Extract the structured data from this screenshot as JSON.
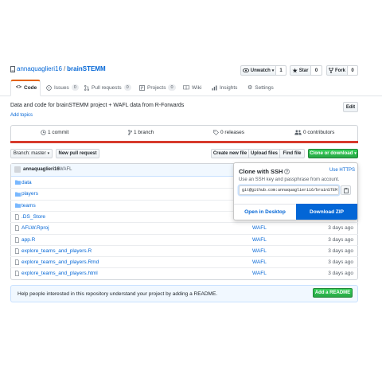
{
  "repo": {
    "owner": "annaquaglieri16",
    "separator": "/",
    "name": "brainSTEMM",
    "description": "Data and code for brainSTEMM project + WAFL data from R-Forwards",
    "add_topics": "Add topics",
    "edit_label": "Edit"
  },
  "actions": {
    "watch_label": "Unwatch",
    "watch_count": "1",
    "star_label": "Star",
    "star_count": "0",
    "fork_label": "Fork",
    "fork_count": "0"
  },
  "tabs": [
    {
      "label": "Code",
      "count": ""
    },
    {
      "label": "Issues",
      "count": "0"
    },
    {
      "label": "Pull requests",
      "count": "0"
    },
    {
      "label": "Projects",
      "count": "0"
    },
    {
      "label": "Wiki",
      "count": ""
    },
    {
      "label": "Insights",
      "count": ""
    },
    {
      "label": "Settings",
      "count": ""
    }
  ],
  "summary": {
    "commits": "1 commit",
    "branches": "1 branch",
    "releases": "0 releases",
    "contributors": "0 contributors"
  },
  "toolbar": {
    "branch_label": "Branch: master",
    "new_pr": "New pull request",
    "create_file": "Create new file",
    "upload_files": "Upload files",
    "find_file": "Find file",
    "clone": "Clone or download"
  },
  "commit": {
    "author": "annaquaglieri16",
    "message": "WAFL"
  },
  "files": [
    {
      "name": "data",
      "type": "folder",
      "message": "",
      "age": ""
    },
    {
      "name": "players",
      "type": "folder",
      "message": "",
      "age": ""
    },
    {
      "name": "teams",
      "type": "folder",
      "message": "",
      "age": ""
    },
    {
      "name": ".DS_Store",
      "type": "file",
      "message": "",
      "age": ""
    },
    {
      "name": "AFLW.Rproj",
      "type": "file",
      "message": "WAFL",
      "age": "3 days ago"
    },
    {
      "name": "app.R",
      "type": "file",
      "message": "WAFL",
      "age": "3 days ago"
    },
    {
      "name": "explore_teams_and_players.R",
      "type": "file",
      "message": "WAFL",
      "age": "3 days ago"
    },
    {
      "name": "explore_teams_and_players.Rmd",
      "type": "file",
      "message": "WAFL",
      "age": "3 days ago"
    },
    {
      "name": "explore_teams_and_players.html",
      "type": "file",
      "message": "WAFL",
      "age": "3 days ago"
    }
  ],
  "readme_banner": {
    "text": "Help people interested in this repository understand your project by adding a README.",
    "button": "Add a README"
  },
  "clone_popup": {
    "title": "Clone with SSH",
    "use_https": "Use HTTPS",
    "hint": "Use an SSH key and passphrase from account.",
    "url": "git@github.com:annaquaglieri16/brainSTEM",
    "open_desktop": "Open in Desktop",
    "download_zip": "Download ZIP"
  },
  "colors": {
    "accent": "#0366d6",
    "green": "#28a745",
    "language_bar_red": "#d73a2c"
  }
}
